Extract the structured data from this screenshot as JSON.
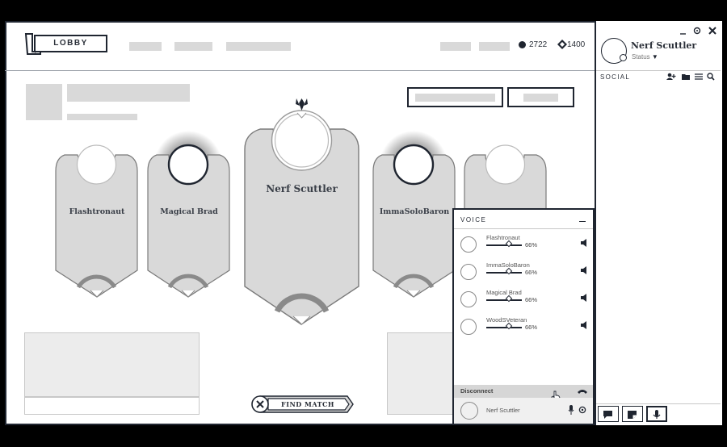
{
  "header": {
    "lobby_label": "LOBBY",
    "rp": "2722",
    "be": "1400"
  },
  "banners": [
    {
      "name": "Flashtronaut"
    },
    {
      "name": "Magical Brad"
    },
    {
      "name": "Nerf Scuttler"
    },
    {
      "name": "ImmaSoloBaron"
    }
  ],
  "find_match": {
    "label": "FIND MATCH"
  },
  "profile": {
    "name": "Nerf Scuttler",
    "status": "Status"
  },
  "social": {
    "label": "SOCIAL"
  },
  "voice": {
    "title": "VOICE",
    "participants": [
      {
        "name": "Flashtronaut",
        "volume": "66%"
      },
      {
        "name": "ImmaSoloBaron",
        "volume": "66%"
      },
      {
        "name": "Magical Brad",
        "volume": "66%"
      },
      {
        "name": "WoodSVeteran",
        "volume": "66%"
      }
    ],
    "disconnect_label": "Disconnect",
    "self_name": "Nerf Scuttler"
  },
  "icons": {
    "close": "close-icon",
    "gear": "gear-icon",
    "minimize": "minimize-icon",
    "add_friend": "add-friend-icon",
    "folder": "folder-icon",
    "list": "list-icon",
    "search": "search-icon",
    "speaker": "speaker-icon",
    "mic": "mic-icon",
    "chat": "chat-icon"
  }
}
